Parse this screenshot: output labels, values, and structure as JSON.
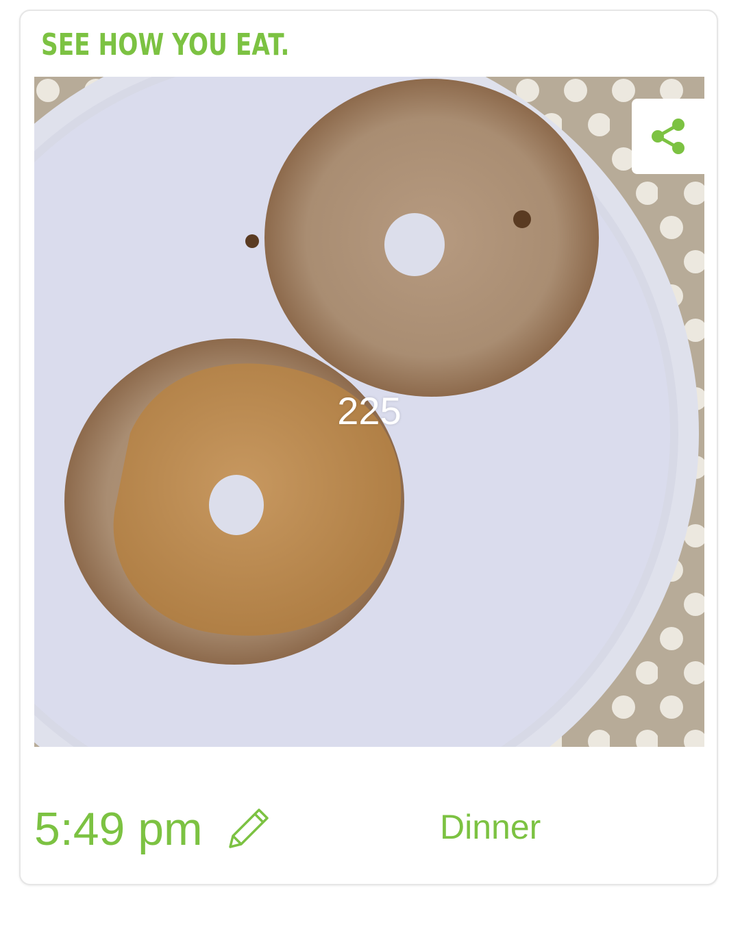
{
  "brand": {
    "tagline": "SEE HOW YOU EAT."
  },
  "entry": {
    "calories": "225",
    "time": "5:49 pm",
    "meal_type": "Dinner"
  },
  "icons": {
    "share": "share-icon",
    "edit": "pencil-icon"
  },
  "colors": {
    "accent": "#7cc242",
    "card_border": "#e6e6e6"
  }
}
